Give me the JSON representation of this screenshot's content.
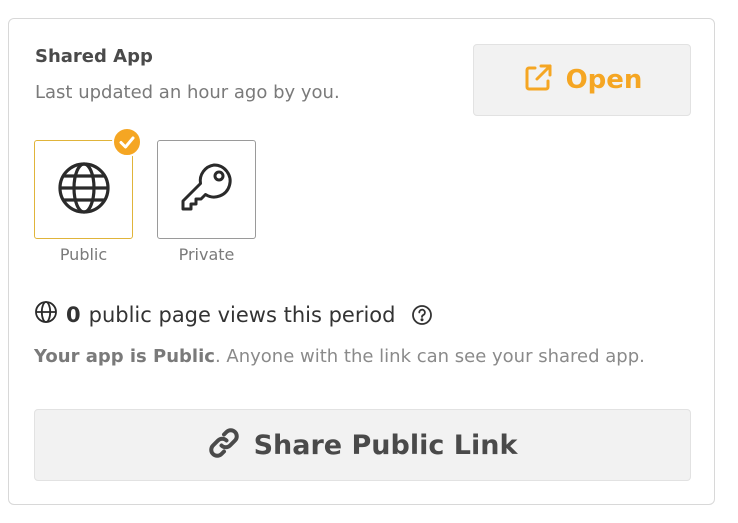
{
  "panel": {
    "title": "Shared App",
    "subtitle": "Last updated an hour ago by you."
  },
  "open_button": {
    "label": "Open",
    "icon": "external-link-icon",
    "color": "#f5a623"
  },
  "visibility": {
    "selected": "public",
    "options": [
      {
        "id": "public",
        "label": "Public",
        "icon": "globe-icon"
      },
      {
        "id": "private",
        "label": "Private",
        "icon": "key-icon"
      }
    ]
  },
  "views": {
    "count": "0",
    "text": "public page views this period"
  },
  "notice": {
    "strong": "Your app is Public",
    "rest": ". Anyone with the link can see your shared app."
  },
  "share_button": {
    "label": "Share Public Link",
    "icon": "link-icon"
  }
}
